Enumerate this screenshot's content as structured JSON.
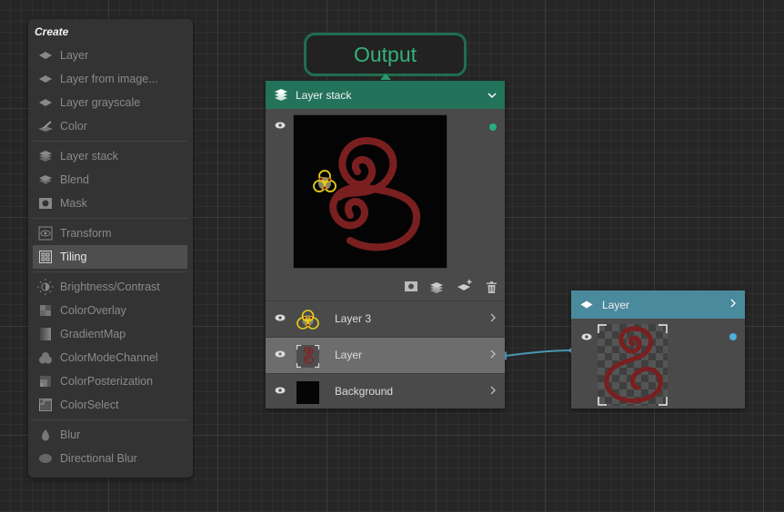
{
  "create_menu": {
    "title": "Create",
    "items": [
      {
        "label": "Layer",
        "icon": "layer-icon"
      },
      {
        "label": "Layer from image...",
        "icon": "layer-icon"
      },
      {
        "label": "Layer grayscale",
        "icon": "layer-icon"
      },
      {
        "label": "Color",
        "icon": "color-dropper-icon"
      },
      {
        "label": "Layer stack",
        "icon": "layer-stack-icon"
      },
      {
        "label": "Blend",
        "icon": "blend-icon"
      },
      {
        "label": "Mask",
        "icon": "mask-icon"
      },
      {
        "label": "Transform",
        "icon": "transform-icon"
      },
      {
        "label": "Tiling",
        "icon": "tiling-icon",
        "selected": true
      },
      {
        "label": "Brightness/Contrast",
        "icon": "brightness-icon"
      },
      {
        "label": "ColorOverlay",
        "icon": "color-overlay-icon"
      },
      {
        "label": "GradientMap",
        "icon": "gradient-map-icon"
      },
      {
        "label": "ColorModeChannel",
        "icon": "color-mode-channel-icon"
      },
      {
        "label": "ColorPosterization",
        "icon": "color-posterization-icon"
      },
      {
        "label": "ColorSelect",
        "icon": "color-select-icon"
      },
      {
        "label": "Blur",
        "icon": "blur-icon"
      },
      {
        "label": "Directional Blur",
        "icon": "directional-blur-icon"
      }
    ]
  },
  "output_node": {
    "label": "Output",
    "accent": "#34b07e"
  },
  "stack_node": {
    "title": "Layer stack",
    "header_color": "#23735a",
    "toolbar": [
      "add-mask-button",
      "add-layer-stack-button",
      "add-layer-button",
      "delete-button"
    ],
    "layers": [
      {
        "name": "Layer 3",
        "thumb": "trefoil"
      },
      {
        "name": "Layer",
        "thumb": "spiral",
        "selected": true
      },
      {
        "name": "Background",
        "thumb": "black"
      }
    ]
  },
  "layer_node": {
    "title": "Layer",
    "header_color": "#4a8a9d",
    "port_color": "#4eaedb"
  }
}
